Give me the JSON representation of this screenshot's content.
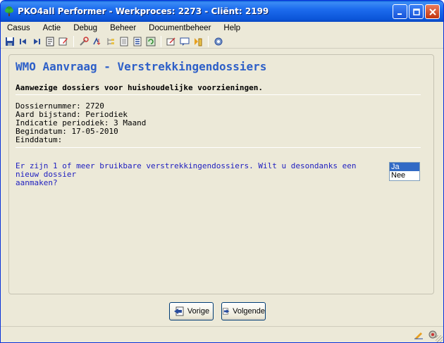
{
  "window": {
    "title": "PKO4all Performer - Werkproces: 2273 - Cliënt: 2199"
  },
  "menu": [
    "Casus",
    "Actie",
    "Debug",
    "Beheer",
    "Documentbeheer",
    "Help"
  ],
  "toolbar": {
    "icons": [
      "save-icon",
      "first-icon",
      "last-icon",
      "notes-icon",
      "edit-icon",
      "tools-icon",
      "sort-icon",
      "tree-icon",
      "document-icon",
      "list-icon",
      "refresh-icon",
      "attach-icon",
      "message-icon",
      "export-icon",
      "settings-icon"
    ]
  },
  "panel": {
    "title": "WMO Aanvraag - Verstrekkingendossiers",
    "subtitle": "Aanwezige dossiers voor huishoudelijke voorzieningen.",
    "details": [
      "Dossiernummer: 2720",
      "Aard bijstand: Periodiek",
      "Indicatie periodiek: 3 Maand",
      "Begindatum: 17-05-2010",
      "Einddatum:"
    ],
    "question_line1": "Er zijn 1 of meer bruikbare verstrekkingendossiers. Wilt u desondanks een nieuw dossier",
    "question_line2": "aanmaken?",
    "options": [
      "Ja",
      "Nee"
    ],
    "selected_option": "Ja"
  },
  "buttons": {
    "prev_label": "Vorige",
    "next_label": "Volgende"
  },
  "colors": {
    "title_accent": "#2d5fc8",
    "question_text": "#2020c0",
    "selection": "#316ac5"
  }
}
